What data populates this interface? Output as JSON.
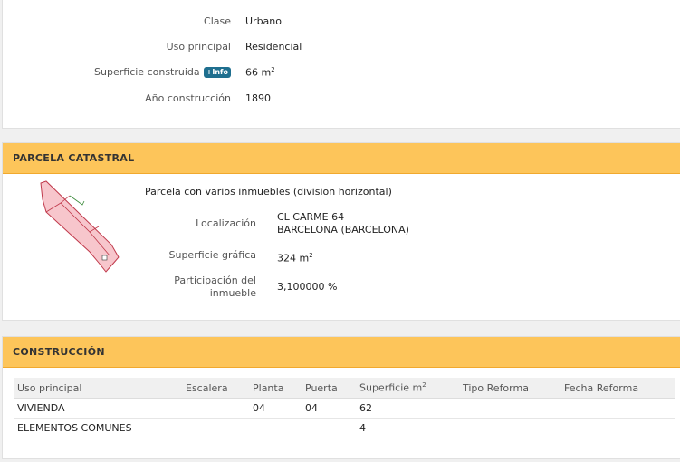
{
  "inmueble": {
    "cut_text": "(                    )",
    "clase_label": "Clase",
    "clase_value": "Urbano",
    "uso_label": "Uso principal",
    "uso_value": "Residencial",
    "superficie_label": "Superficie construida",
    "info_badge": "+Info",
    "superficie_value": "66 m",
    "superficie_unit_sup": "2",
    "anio_label": "Año construcción",
    "anio_value": "1890"
  },
  "parcela": {
    "title": "PARCELA CATASTRAL",
    "description": "Parcela con varios inmuebles (division horizontal)",
    "localizacion_label": "Localización",
    "localizacion_line1": "CL CARME 64",
    "localizacion_line2": "BARCELONA (BARCELONA)",
    "superficie_label": "Superficie gráfica",
    "superficie_value": "324 m",
    "superficie_unit_sup": "2",
    "participacion_label_line1": "Participación del",
    "participacion_label_line2": "inmueble",
    "participacion_value": "3,100000 %"
  },
  "construccion": {
    "title": "CONSTRUCCIÓN",
    "columns": [
      "Uso principal",
      "Escalera",
      "Planta",
      "Puerta",
      "Superficie m",
      "Tipo Reforma",
      "Fecha Reforma"
    ],
    "superficie_col_sup": "2",
    "rows": [
      [
        "VIVIENDA",
        "",
        "04",
        "04",
        "62",
        "",
        ""
      ],
      [
        "ELEMENTOS COMUNES",
        "",
        "",
        "",
        "4",
        "",
        ""
      ]
    ]
  },
  "colors": {
    "header_bg": "#fdc55a",
    "info_badge": "#1f6f8f",
    "parcel_fill": "#f7c6cc",
    "parcel_stroke": "#c0394b"
  }
}
